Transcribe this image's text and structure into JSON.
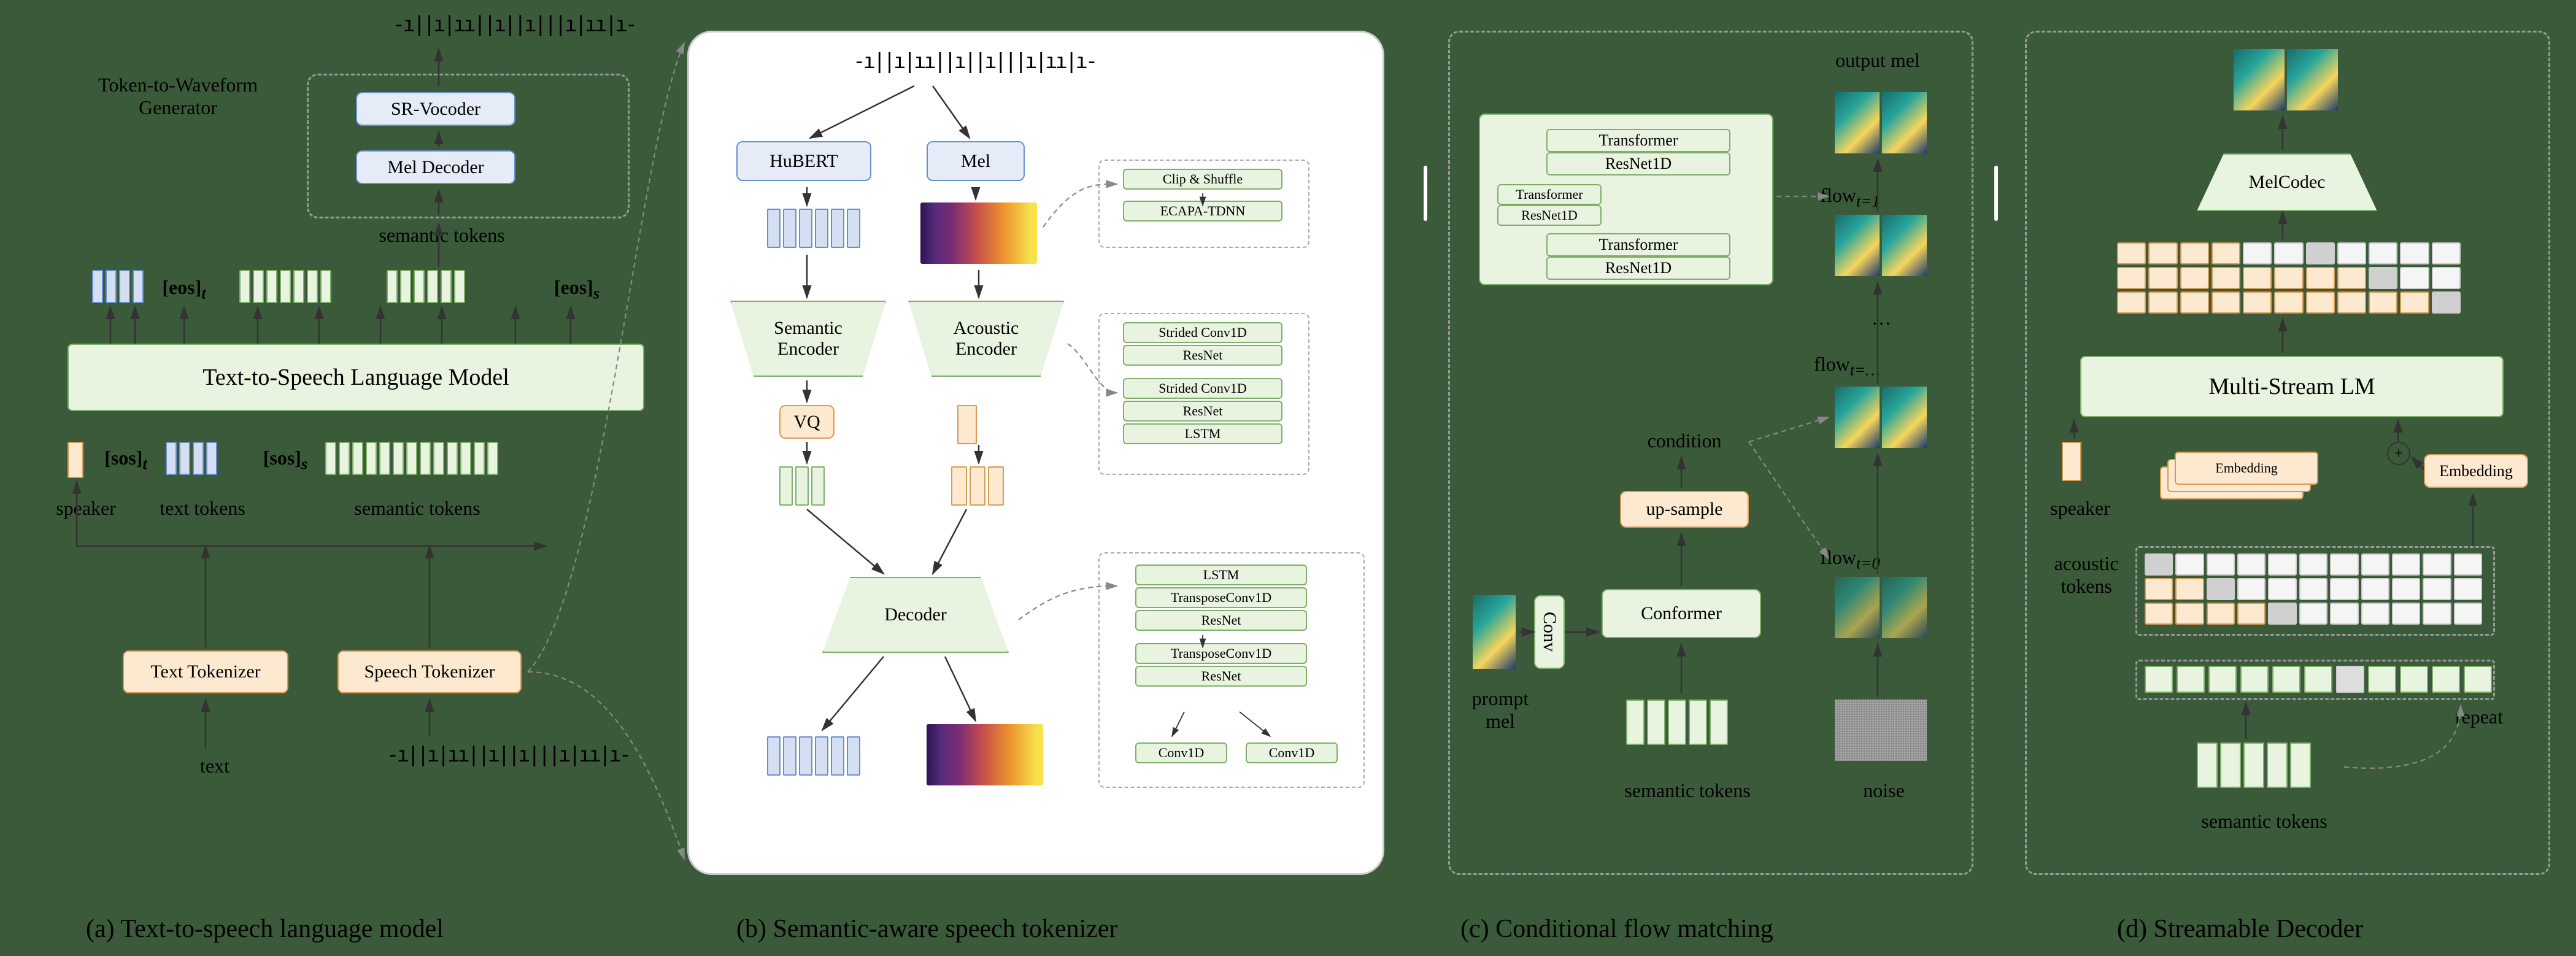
{
  "captions": {
    "a": "(a) Text-to-speech language model",
    "b": "(b) Semantic-aware speech tokenizer",
    "c": "(c) Conditional flow matching",
    "d": "(d) Streamable Decoder"
  },
  "panel_a": {
    "tgen_label": "Token-to-Waveform\nGenerator",
    "sr_vocoder": "SR-Vocoder",
    "mel_decoder": "Mel Decoder",
    "semantic_tokens_top": "semantic tokens",
    "eos_t": "[eos]_t",
    "eos_s": "[eos]_s",
    "lm": "Text-to-Speech Language Model",
    "sos_t": "[sos]_t",
    "sos_s": "[sos]_s",
    "speaker": "speaker",
    "text_tokens": "text tokens",
    "semantic_tokens_in": "semantic tokens",
    "text_tokenizer": "Text Tokenizer",
    "speech_tokenizer": "Speech Tokenizer",
    "text": "text"
  },
  "panel_b": {
    "hubert": "HuBERT",
    "mel": "Mel",
    "sem_encoder": "Semantic\nEncoder",
    "ac_encoder": "Acoustic\nEncoder",
    "vq": "VQ",
    "decoder": "Decoder",
    "detail1": [
      "Clip & Shuffle",
      "ECAPA-TDNN"
    ],
    "detail2": [
      "Strided Conv1D",
      "ResNet",
      "Strided Conv1D",
      "ResNet",
      "LSTM"
    ],
    "detail3": [
      "LSTM",
      "TransposeConv1D",
      "ResNet",
      "TransposeConv1D",
      "ResNet",
      "Conv1D",
      "Conv1D"
    ]
  },
  "panel_c": {
    "output_mel": "output mel",
    "transformer": "Transformer",
    "resnet1d": "ResNet1D",
    "flow_t1": "flow_{t=1}",
    "flow_tdots": "flow_{t=…}",
    "flow_t0": "flow_{t=0}",
    "dots": "…",
    "condition": "condition",
    "upsample": "up-sample",
    "conformer": "Conformer",
    "conv": "Conv",
    "prompt_mel": "prompt\nmel",
    "semantic_tokens": "semantic tokens",
    "noise": "noise"
  },
  "panel_d": {
    "melcodec": "MelCodec",
    "multistream": "Multi-Stream LM",
    "speaker": "speaker",
    "embedding": "Embedding",
    "embedding_r": "Embedding",
    "acoustic_tokens": "acoustic\ntokens",
    "repeat": "repeat",
    "semantic_tokens": "semantic tokens"
  }
}
